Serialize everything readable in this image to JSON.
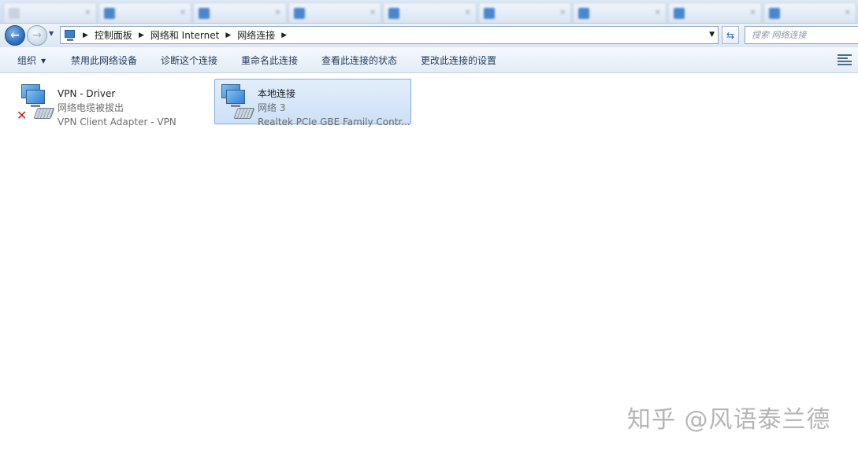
{
  "tabs": [
    {
      "label": "",
      "icon": "tab-page-icon"
    },
    {
      "label": "",
      "icon": "tab-page-icon"
    },
    {
      "label": "",
      "icon": "tab-page-icon"
    },
    {
      "label": "",
      "icon": "tab-page-icon"
    },
    {
      "label": "",
      "icon": "tab-page-icon"
    },
    {
      "label": "",
      "icon": "tab-page-icon"
    },
    {
      "label": "",
      "icon": "tab-page-icon"
    },
    {
      "label": "",
      "icon": "tab-page-icon"
    },
    {
      "label": "",
      "icon": "tab-page-icon"
    }
  ],
  "address": {
    "breadcrumbs": [
      "控制面板",
      "网络和 Internet",
      "网络连接"
    ]
  },
  "search": {
    "placeholder": "搜索 网络连接"
  },
  "toolbar": {
    "organize": "组织",
    "disable": "禁用此网络设备",
    "diagnose": "诊断这个连接",
    "rename": "重命名此连接",
    "status": "查看此连接的状态",
    "settings": "更改此连接的设置"
  },
  "connections": [
    {
      "name": "VPN - Driver",
      "status": "网络电缆被拔出",
      "adapter": "VPN Client Adapter - VPN",
      "selected": false,
      "disconnected": true
    },
    {
      "name": "本地连接",
      "status": "网络  3",
      "adapter": "Realtek PCIe GBE Family Contr...",
      "selected": true,
      "disconnected": false
    }
  ],
  "watermark": "知乎 @风语泰兰德",
  "colors": {
    "accent": "#2a66b8",
    "selection": "#cde0f7",
    "error": "#d21b1b"
  }
}
